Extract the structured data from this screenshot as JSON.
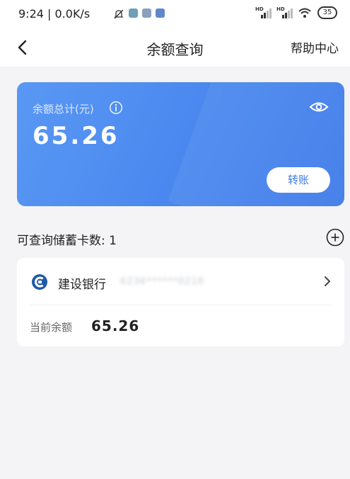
{
  "status_bar": {
    "time": "9:24 | 0.0K/s",
    "battery": "35"
  },
  "nav": {
    "title": "余额查询",
    "help_label": "帮助中心"
  },
  "balance_card": {
    "label": "余额总计(元)",
    "amount": "65.26",
    "transfer_label": "转账"
  },
  "card_count": {
    "label": "可查询储蓄卡数: 1"
  },
  "bank_card": {
    "bank_name": "建设银行",
    "card_number_masked": "6236******0216",
    "current_balance_label": "当前余额",
    "current_balance": "65.26"
  },
  "colors": {
    "accent": "#4c8af0",
    "background": "#f4f4f6",
    "bank_logo": "#1f5aa8"
  },
  "icons": [
    "back-icon",
    "info-icon",
    "eye-icon",
    "add-icon",
    "bank-logo-icon",
    "chevron-right-icon",
    "wifi-icon",
    "signal-icon",
    "battery-icon"
  ]
}
